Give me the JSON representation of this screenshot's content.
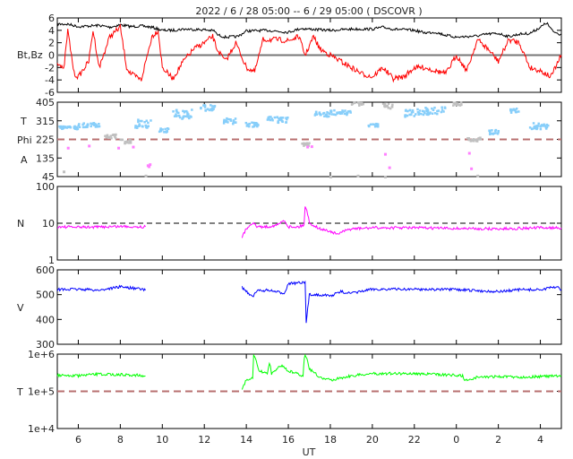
{
  "chart_data": [
    {
      "type": "line",
      "title": "2022 /  6 / 28   05:00  --   6 / 29   05:00 ( DSCOVR )",
      "ylabel": "Bt,Bz",
      "ylim": [
        -6,
        6
      ],
      "yticks": [
        6,
        4,
        2,
        0,
        -2,
        -4,
        -6
      ],
      "reference": 0,
      "series": [
        {
          "name": "Bt",
          "color": "#000000",
          "points": [
            [
              5,
              5
            ],
            [
              5.5,
              5
            ],
            [
              6,
              4.6
            ],
            [
              7,
              4.8
            ],
            [
              7.5,
              4.5
            ],
            [
              8,
              4.9
            ],
            [
              8.5,
              4.6
            ],
            [
              9,
              4.7
            ],
            [
              9.5,
              4.5
            ],
            [
              10,
              4
            ],
            [
              10.5,
              4
            ],
            [
              11,
              4.2
            ],
            [
              12,
              4.1
            ],
            [
              12.5,
              3.9
            ],
            [
              12.6,
              3.3
            ],
            [
              13,
              2.9
            ],
            [
              13.6,
              3
            ],
            [
              14,
              3.9
            ],
            [
              15,
              4
            ],
            [
              16,
              3.7
            ],
            [
              16.6,
              4.3
            ],
            [
              17,
              4.2
            ],
            [
              18,
              4
            ],
            [
              19,
              4.2
            ],
            [
              20,
              4.2
            ],
            [
              20.5,
              4.5
            ],
            [
              21,
              4.2
            ],
            [
              22,
              4
            ],
            [
              22.5,
              3.6
            ],
            [
              23,
              3.7
            ],
            [
              23.5,
              3.2
            ],
            [
              24,
              2.9
            ],
            [
              24.5,
              3
            ],
            [
              25,
              3.1
            ],
            [
              25.5,
              3.4
            ],
            [
              26,
              3.5
            ],
            [
              26.5,
              3
            ],
            [
              27,
              3.4
            ],
            [
              27.5,
              3.5
            ],
            [
              28,
              4.5
            ],
            [
              28.3,
              5.2
            ],
            [
              28.6,
              3.8
            ],
            [
              29,
              3.3
            ]
          ]
        },
        {
          "name": "Bz",
          "color": "#ff0000",
          "points": [
            [
              5,
              -1
            ],
            [
              5.3,
              -2.5
            ],
            [
              5.5,
              4
            ],
            [
              5.8,
              -3
            ],
            [
              6,
              -3.5
            ],
            [
              6.5,
              -1
            ],
            [
              6.7,
              4
            ],
            [
              7,
              -2
            ],
            [
              7.5,
              3
            ],
            [
              8,
              4.5
            ],
            [
              8.3,
              -2
            ],
            [
              8.5,
              -3
            ],
            [
              9,
              -4
            ],
            [
              9.5,
              3
            ],
            [
              9.8,
              4
            ],
            [
              10,
              -2
            ],
            [
              10.5,
              -3.8
            ],
            [
              11,
              -1
            ],
            [
              11.5,
              1
            ],
            [
              12,
              2
            ],
            [
              12.4,
              3
            ],
            [
              12.6,
              1
            ],
            [
              13,
              -1
            ],
            [
              13.5,
              2
            ],
            [
              14,
              -2
            ],
            [
              14.4,
              -2.7
            ],
            [
              14.8,
              2.5
            ],
            [
              15.5,
              2.5
            ],
            [
              16,
              2.3
            ],
            [
              16.5,
              3
            ],
            [
              16.8,
              0
            ],
            [
              17.2,
              3
            ],
            [
              17.5,
              1
            ],
            [
              18,
              0
            ],
            [
              18.5,
              -1
            ],
            [
              19,
              -2
            ],
            [
              19.5,
              -3
            ],
            [
              20,
              -3.5
            ],
            [
              20.5,
              -2
            ],
            [
              21,
              -3.8
            ],
            [
              21.5,
              -3.5
            ],
            [
              22,
              -2
            ],
            [
              22.5,
              -2
            ],
            [
              23,
              -2.5
            ],
            [
              23.5,
              -3
            ],
            [
              24,
              0
            ],
            [
              24.5,
              -2.5
            ],
            [
              25,
              2.5
            ],
            [
              25.5,
              1
            ],
            [
              26,
              -1
            ],
            [
              26.5,
              2.5
            ],
            [
              27,
              2
            ],
            [
              27.5,
              -2
            ],
            [
              28,
              -2.5
            ],
            [
              28.5,
              -3.5
            ],
            [
              29,
              0
            ]
          ]
        }
      ]
    },
    {
      "type": "scatter",
      "ylabel_lines": [
        "T",
        "Phi",
        "A"
      ],
      "ylim": [
        45,
        405
      ],
      "yticks": [
        405,
        315,
        225,
        135,
        45
      ],
      "reference": 225,
      "colors": {
        "c": "#87cefa",
        "g": "#c0c0c0",
        "m": "#ff80ff"
      },
      "clusters": [
        [
          5,
          6,
          275,
          290,
          "c"
        ],
        [
          6,
          7,
          285,
          305,
          "c"
        ],
        [
          7.2,
          7.8,
          230,
          250,
          "g"
        ],
        [
          8,
          8.5,
          205,
          225,
          "g"
        ],
        [
          8.7,
          9.5,
          280,
          330,
          "c"
        ],
        [
          9.8,
          10.3,
          260,
          280,
          "c"
        ],
        [
          10.5,
          11.5,
          325,
          370,
          "c"
        ],
        [
          11.8,
          12.5,
          365,
          392,
          "c"
        ],
        [
          12.8,
          13.5,
          295,
          330,
          "c"
        ],
        [
          13.9,
          14.6,
          285,
          310,
          "c"
        ],
        [
          15,
          16,
          305,
          335,
          "c"
        ],
        [
          16.5,
          17,
          195,
          208,
          "g"
        ],
        [
          17.2,
          18,
          335,
          360,
          "c"
        ],
        [
          18,
          19,
          345,
          368,
          "c"
        ],
        [
          19,
          19.6,
          390,
          405,
          "g"
        ],
        [
          19.8,
          20.3,
          285,
          305,
          "c"
        ],
        [
          20.5,
          21,
          375,
          400,
          "g"
        ],
        [
          21.5,
          22.5,
          335,
          372,
          "c"
        ],
        [
          22.5,
          23.5,
          345,
          382,
          "c"
        ],
        [
          23.8,
          24.3,
          390,
          405,
          "g"
        ],
        [
          24.5,
          25.2,
          215,
          235,
          "g"
        ],
        [
          25.5,
          26,
          250,
          272,
          "c"
        ],
        [
          26.5,
          27,
          355,
          375,
          "c"
        ],
        [
          27.5,
          28.5,
          275,
          305,
          "c"
        ]
      ],
      "points": [
        [
          5.5,
          185,
          "m"
        ],
        [
          6.5,
          195,
          "m"
        ],
        [
          7.9,
          185,
          "m"
        ],
        [
          8.6,
          190,
          "m"
        ],
        [
          9.3,
          100,
          "m"
        ],
        [
          9.35,
          95,
          "m"
        ],
        [
          9.4,
          105,
          "m"
        ],
        [
          16.9,
          190,
          "m"
        ],
        [
          17.1,
          192,
          "m"
        ],
        [
          20.6,
          155,
          "m"
        ],
        [
          20.8,
          90,
          "m"
        ],
        [
          24.6,
          160,
          "m"
        ],
        [
          24.7,
          85,
          "m"
        ],
        [
          5.3,
          70,
          "g"
        ],
        [
          9.2,
          50,
          "g"
        ],
        [
          18,
          45,
          "g"
        ],
        [
          19.3,
          50,
          "g"
        ],
        [
          20.6,
          45,
          "g"
        ],
        [
          25,
          50,
          "g"
        ]
      ]
    },
    {
      "type": "line",
      "ylabel": "N",
      "scale": "log",
      "ylim": [
        1,
        100
      ],
      "yticks": [
        100,
        10,
        1
      ],
      "reference": 10,
      "series": [
        {
          "name": "N",
          "color": "#ff00ff",
          "segments": [
            [
              [
                5,
                8
              ],
              [
                6,
                7.8
              ],
              [
                7,
                7.9
              ],
              [
                8,
                8.2
              ],
              [
                9,
                8
              ],
              [
                9.2,
                8
              ]
            ],
            [
              [
                13.8,
                4
              ],
              [
                14,
                7
              ],
              [
                14.3,
                10.5
              ],
              [
                14.5,
                8
              ],
              [
                15,
                8
              ],
              [
                15.5,
                9
              ],
              [
                15.8,
                12
              ],
              [
                16,
                8
              ],
              [
                16.5,
                8
              ],
              [
                16.75,
                9
              ],
              [
                16.8,
                30
              ],
              [
                17,
                10
              ],
              [
                17.5,
                7
              ],
              [
                18,
                6
              ],
              [
                18.3,
                5
              ],
              [
                19,
                7
              ],
              [
                20,
                7.5
              ],
              [
                22,
                7.5
              ],
              [
                24,
                7.2
              ],
              [
                26,
                7
              ],
              [
                28,
                7.5
              ],
              [
                29,
                7.5
              ]
            ]
          ]
        }
      ]
    },
    {
      "type": "line",
      "ylabel": "V",
      "ylim": [
        300,
        600
      ],
      "yticks": [
        600,
        500,
        400,
        300
      ],
      "series": [
        {
          "name": "V",
          "color": "#0000ff",
          "segments": [
            [
              [
                5,
                520
              ],
              [
                6,
                522
              ],
              [
                7,
                518
              ],
              [
                8,
                532
              ],
              [
                9,
                522
              ],
              [
                9.2,
                518
              ]
            ],
            [
              [
                13.8,
                530
              ],
              [
                14.3,
                490
              ],
              [
                14.5,
                515
              ],
              [
                15,
                518
              ],
              [
                15.8,
                505
              ],
              [
                16,
                545
              ],
              [
                16.8,
                548
              ],
              [
                16.85,
                385
              ],
              [
                17,
                500
              ],
              [
                17.5,
                500
              ],
              [
                18,
                495
              ],
              [
                18.5,
                512
              ],
              [
                19,
                505
              ],
              [
                20,
                522
              ],
              [
                22,
                522
              ],
              [
                24,
                520
              ],
              [
                26,
                512
              ],
              [
                27,
                520
              ],
              [
                28,
                520
              ],
              [
                28.8,
                532
              ],
              [
                29,
                520
              ]
            ]
          ]
        }
      ]
    },
    {
      "type": "line",
      "ylabel": "T",
      "scale": "log",
      "ylim": [
        10000,
        1000000
      ],
      "yticks": [
        "1e+6",
        "1e+5",
        "1e+4"
      ],
      "reference": 100000,
      "xlabel": "UT",
      "xticks": [
        "6",
        "8",
        "10",
        "12",
        "14",
        "16",
        "18",
        "20",
        "22",
        "0",
        "2",
        "4"
      ],
      "xtick_hours": [
        6,
        8,
        10,
        12,
        14,
        16,
        18,
        20,
        22,
        24,
        26,
        28
      ],
      "xlim": [
        5,
        29
      ],
      "series": [
        {
          "name": "T",
          "color": "#00ff00",
          "segments": [
            [
              [
                5,
                270000
              ],
              [
                6,
                260000
              ],
              [
                7,
                290000
              ],
              [
                8,
                280000
              ],
              [
                9,
                270000
              ],
              [
                9.2,
                260000
              ]
            ],
            [
              [
                13.8,
                110000
              ],
              [
                14,
                200000
              ],
              [
                14.3,
                220000
              ],
              [
                14.35,
                900000
              ],
              [
                14.6,
                350000
              ],
              [
                15,
                300000
              ],
              [
                15.1,
                600000
              ],
              [
                15.2,
                300000
              ],
              [
                15.7,
                500000
              ],
              [
                16,
                350000
              ],
              [
                16.7,
                260000
              ],
              [
                16.8,
                1000000
              ],
              [
                17,
                400000
              ],
              [
                17.5,
                230000
              ],
              [
                18,
                200000
              ],
              [
                18.5,
                230000
              ],
              [
                19,
                260000
              ],
              [
                20,
                300000
              ],
              [
                21,
                300000
              ],
              [
                22,
                300000
              ],
              [
                24,
                270000
              ],
              [
                24.3,
                260000
              ],
              [
                24.4,
                190000
              ],
              [
                25,
                240000
              ],
              [
                26,
                250000
              ],
              [
                27,
                240000
              ],
              [
                28,
                250000
              ],
              [
                29,
                260000
              ]
            ]
          ]
        }
      ]
    }
  ]
}
